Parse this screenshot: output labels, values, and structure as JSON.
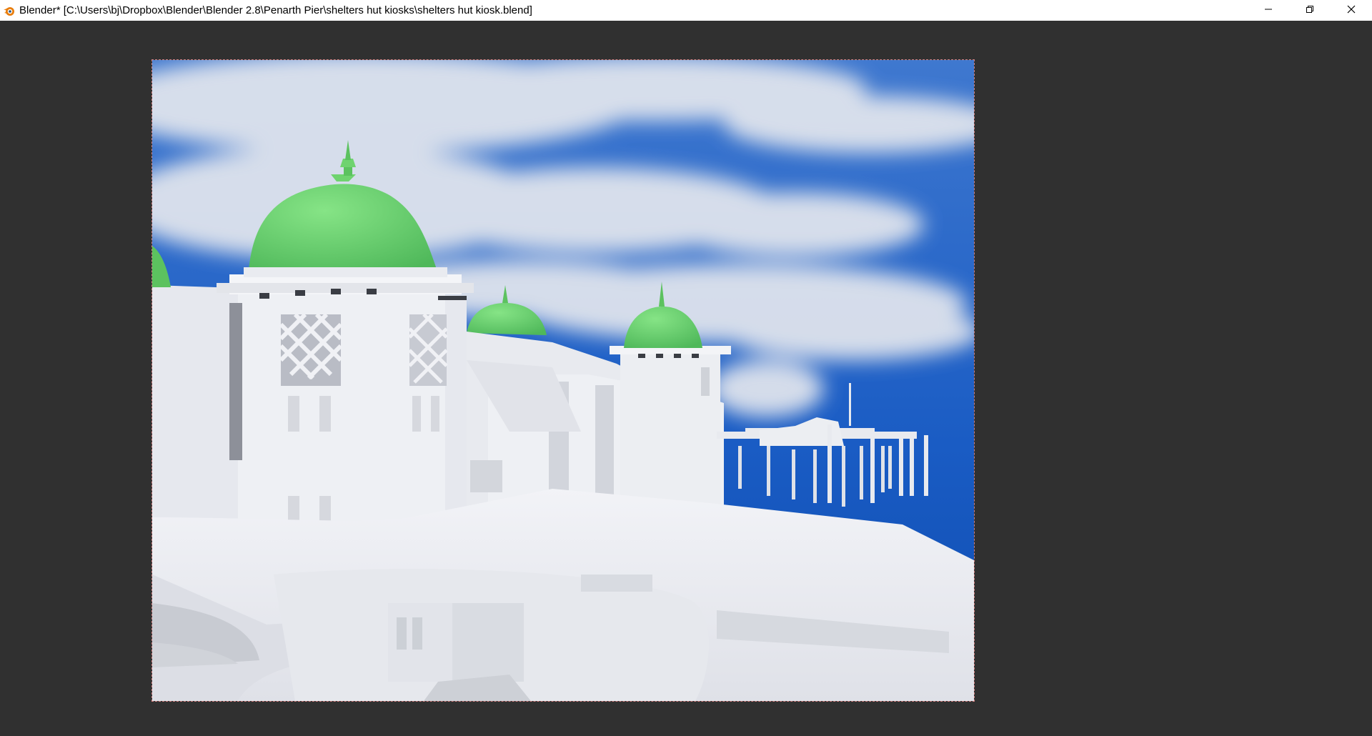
{
  "window": {
    "title": "Blender* [C:\\Users\\bj\\Dropbox\\Blender\\Blender 2.8\\Penarth Pier\\shelters hut kiosks\\shelters hut kiosk.blend]",
    "app_icon": "blender-logo-icon",
    "controls": [
      "minimize-icon",
      "restore-icon",
      "close-icon"
    ]
  },
  "render": {
    "subject": "render-result-image",
    "colors": {
      "sky": "#1a5cc4",
      "cloud": "#e4e7ee",
      "dome": "#6fd36f",
      "building": "#eceef3",
      "background": "#303030"
    }
  }
}
